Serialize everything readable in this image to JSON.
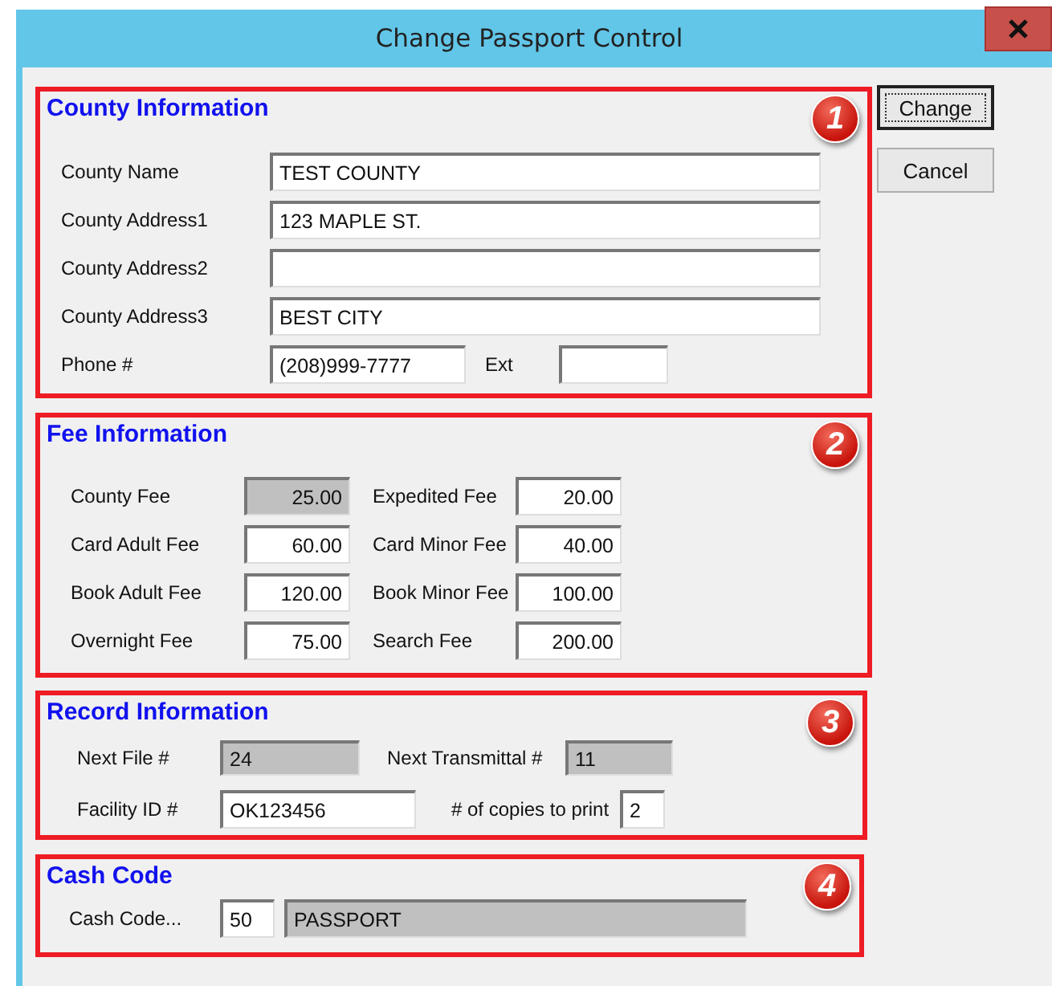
{
  "window": {
    "title": "Change Passport Control"
  },
  "sections": [
    {
      "kind": "county",
      "title": "County Information",
      "badge": "1",
      "rows": [
        [
          {
            "label": "County Name",
            "value": "TEST COUNTY",
            "disabled": false
          }
        ],
        [
          {
            "label": "County Address1",
            "value": "123 MAPLE ST.",
            "disabled": false
          }
        ],
        [
          {
            "label": "County Address2",
            "disabled": false
          }
        ],
        [
          {
            "label": "County Address3",
            "value": "BEST CITY",
            "disabled": false
          }
        ],
        [
          {
            "label": "Phone #",
            "value": "(208)999-7777",
            "disabled": false
          },
          {
            "label": "Ext",
            "disabled": false
          }
        ]
      ]
    },
    {
      "kind": "fee",
      "title": "Fee Information",
      "badge": "2",
      "rows": [
        [
          {
            "label": "County Fee",
            "value": "25.00",
            "disabled": true
          },
          {
            "label": "Expedited Fee",
            "value": "20.00",
            "disabled": false
          }
        ],
        [
          {
            "label": "Card Adult Fee",
            "value": "60.00",
            "disabled": false
          },
          {
            "label": "Card Minor Fee",
            "value": "40.00",
            "disabled": false
          }
        ],
        [
          {
            "label": "Book Adult Fee",
            "value": "120.00",
            "disabled": false
          },
          {
            "label": "Book Minor Fee",
            "value": "100.00",
            "disabled": false
          }
        ],
        [
          {
            "label": "Overnight Fee",
            "value": "75.00",
            "disabled": false
          },
          {
            "label": "Search Fee",
            "value": "200.00",
            "disabled": false
          }
        ]
      ]
    },
    {
      "kind": "record",
      "title": "Record Information",
      "badge": "3",
      "rows": [
        [
          {
            "label": "Next File #",
            "value": "24",
            "disabled": true
          },
          {
            "label": "Next Transmittal #",
            "value": "11",
            "disabled": true
          }
        ],
        [
          {
            "label": "Facility ID #",
            "value": "OK123456",
            "disabled": false
          },
          {
            "label": "# of copies to print",
            "value": "2",
            "disabled": false
          }
        ]
      ]
    },
    {
      "kind": "cash",
      "title": "Cash Code",
      "badge": "4",
      "rows": [
        [
          {
            "label": "Cash Code...",
            "value": "50",
            "disabled": false
          },
          {
            "value": "PASSPORT",
            "disabled": true
          }
        ]
      ]
    }
  ],
  "buttons": [
    {
      "label": "Change",
      "default": true
    },
    {
      "label": "Cancel",
      "default": false
    }
  ]
}
